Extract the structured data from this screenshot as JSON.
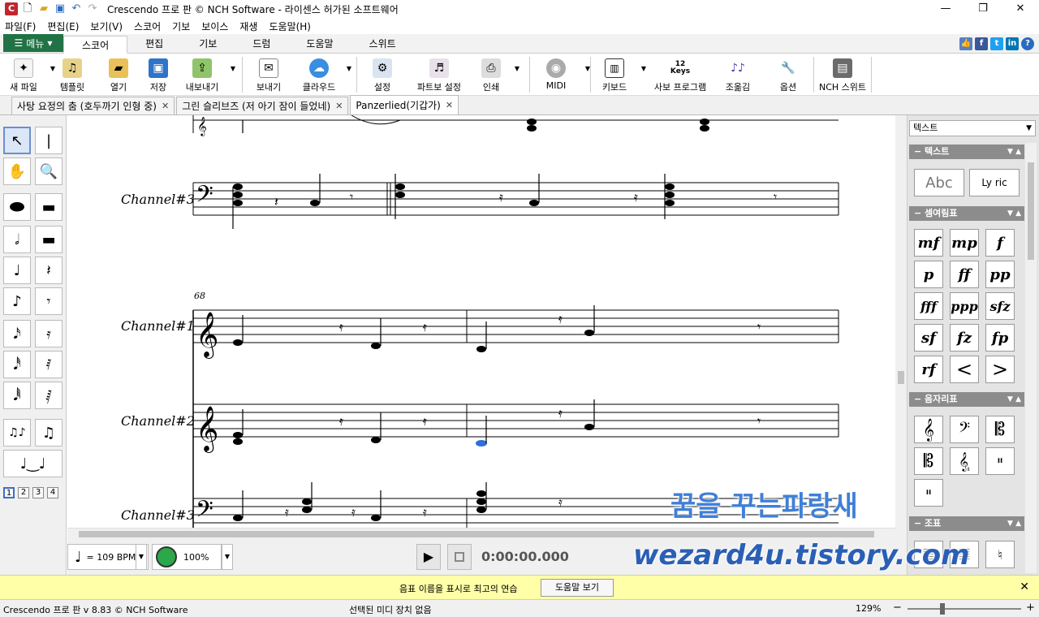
{
  "window": {
    "title": "Crescendo 프로 판 © NCH Software - 라이센스 허가된 소프트웨어"
  },
  "menu": [
    "파일(F)",
    "편집(E)",
    "보기(V)",
    "스코어",
    "기보",
    "보이스",
    "재생",
    "도움말(H)"
  ],
  "ribbon_tabs": {
    "menu_button": "메뉴",
    "tabs": [
      "스코어",
      "편집",
      "기보",
      "드럼",
      "도움말",
      "스위트"
    ],
    "active": "스코어"
  },
  "toolbar": [
    "새 파일",
    "템플릿",
    "열기",
    "저장",
    "내보내기",
    "보내기",
    "클라우드",
    "설정",
    "파트보 설정",
    "인쇄",
    "MIDI",
    "키보드",
    "사보 프로그램",
    "조옮김",
    "옵션",
    "NCH 스위트"
  ],
  "keys_icon_text": "12\nKeys",
  "doc_tabs": [
    "사탕 요정의 춤 (호두까기 인형 중)",
    "그린 슬리브즈 (저 아기 잠이 들었네)",
    "Panzerlied(기갑가)"
  ],
  "active_doc_tab": "Panzerlied(기갑가)",
  "palette_pages": [
    "1",
    "2",
    "3",
    "4"
  ],
  "score": {
    "staves": [
      "Channel#3",
      "Channel#1",
      "Channel#2",
      "Channel#3"
    ],
    "measure_number": "68"
  },
  "playback": {
    "tempo": "= 109 BPM",
    "volume": "100%",
    "time": "0:00:00.000"
  },
  "right_panel": {
    "dropdown": "텍스트",
    "sections": [
      "텍스트",
      "셈여림표",
      "음자리표",
      "조표"
    ],
    "text_items": [
      "Abc",
      "Ly ric"
    ],
    "dynamics": [
      "mf",
      "mp",
      "f",
      "p",
      "ff",
      "pp",
      "fff",
      "ppp",
      "sfz",
      "sf",
      "fz",
      "fp",
      "rf",
      "<",
      ">"
    ]
  },
  "tip": {
    "text": "음표 이름을 표시로 최고의 연습",
    "button": "도움말 보기"
  },
  "status": {
    "version": "Crescendo 프로 판 v 8.83 © NCH Software",
    "midi": "선택된 미디 장치 없음",
    "zoom": "129%"
  },
  "watermark": {
    "line1": "꿈을 꾸는파랑새",
    "line2": "wezard4u.tistory.com"
  },
  "colors": {
    "menu_green": "#217346",
    "tip_yellow": "#ffffa8",
    "watermark_blue": "#2a5fb5"
  }
}
